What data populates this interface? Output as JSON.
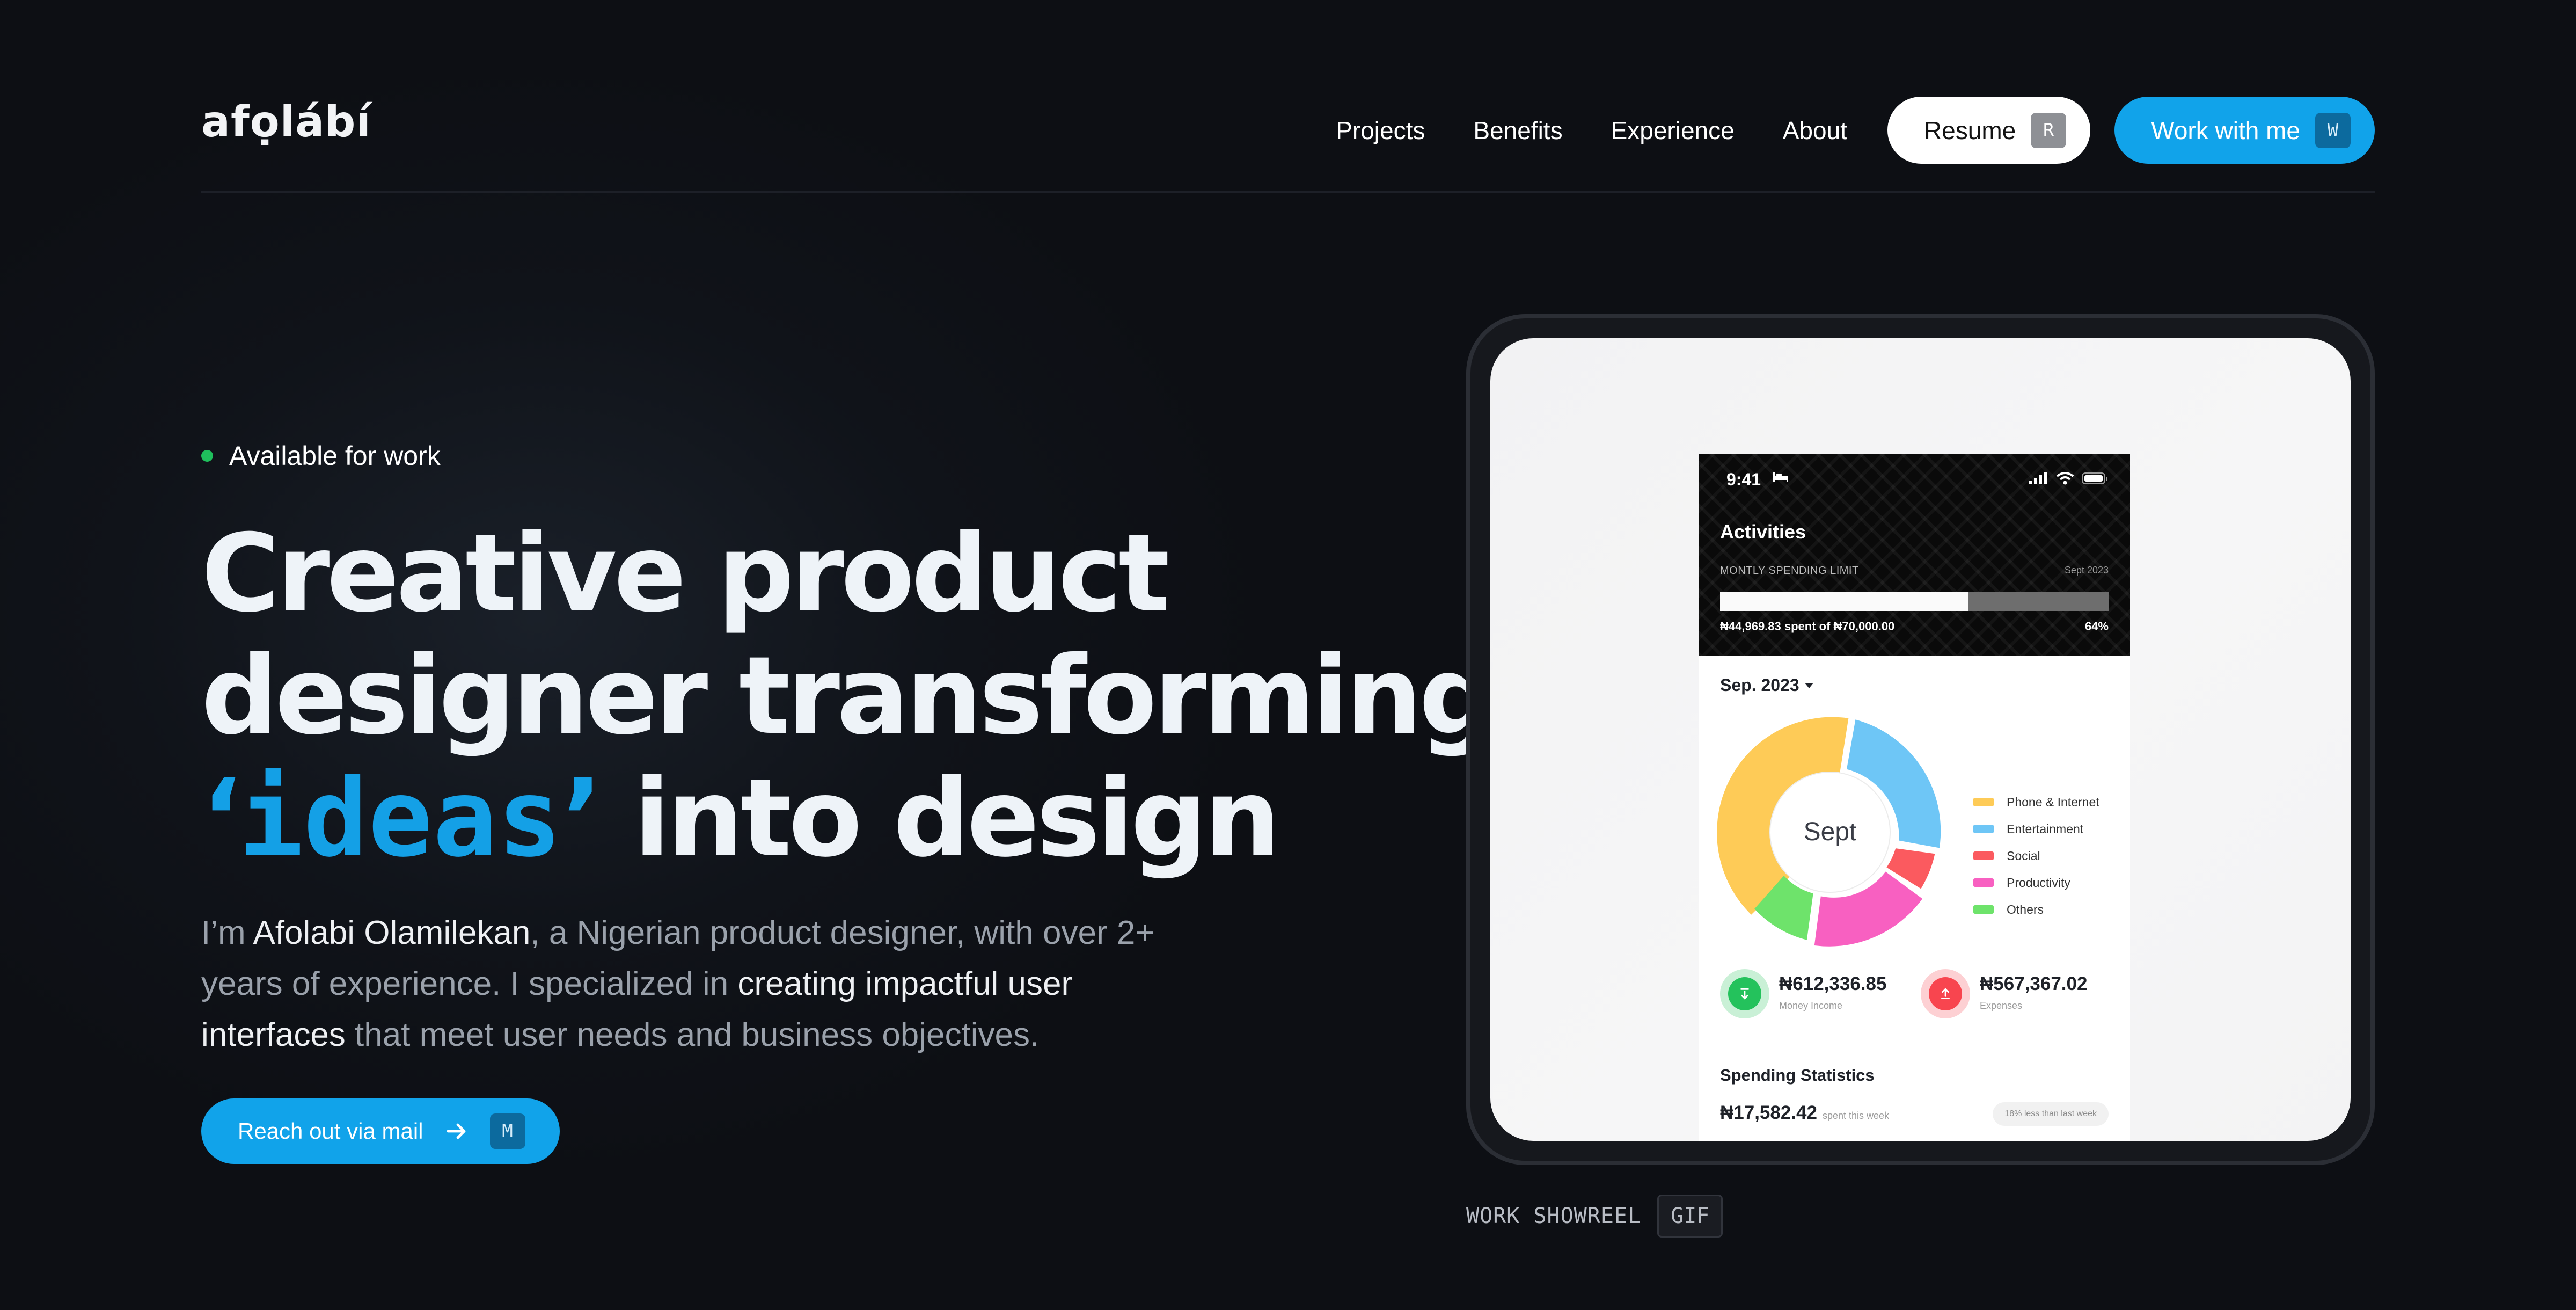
{
  "nav": {
    "logo": "afọlábí",
    "links": [
      "Projects",
      "Benefits",
      "Experience",
      "About"
    ],
    "resume_label": "Resume",
    "resume_key": "R",
    "work_label": "Work with me",
    "work_key": "W"
  },
  "hero": {
    "availability": "Available for work",
    "headline": {
      "line1": "Creative product",
      "line2": "designer transforming",
      "open_quote": "‘",
      "ideas": "ideas",
      "close_quote": "’",
      "line3_rest": "into design"
    },
    "bio": {
      "p1": "I’m ",
      "name": "Afolabi Olamilekan",
      "p2": ", a Nigerian product designer, with over 2+ years of experience. I specialized in ",
      "em2": "creating impactful user interfaces",
      "p3": " that meet user needs and business objectives."
    },
    "cta_label": "Reach out via mail",
    "cta_key": "M"
  },
  "showreel": {
    "label": "WORK SHOWREEL",
    "badge": "GIF"
  },
  "app": {
    "time": "9:41",
    "title": "Activities",
    "limit_label": "MONTLY SPENDING LIMIT",
    "limit_date": "Sept 2023",
    "progress_fraction": 0.64,
    "spent_text": "₦44,969.83 spent of ₦70,000.00",
    "percent_text": "64%",
    "month_selector": "Sep. 2023",
    "donut_center": "Sept",
    "legend": [
      "Phone & Internet",
      "Entertainment",
      "Social",
      "Productivity",
      "Others"
    ],
    "colors": {
      "phone": "#fecb57",
      "entertainment": "#6ec6f6",
      "social": "#fb5a5f",
      "productivity": "#f860c1",
      "others": "#6ee36b",
      "accent": "#11a3ea",
      "income": "#24c25c",
      "expense": "#f8454f"
    },
    "income_value": "₦612,336.85",
    "income_label": "Money Income",
    "expense_value": "₦567,367.02",
    "expense_label": "Expenses",
    "spending_title": "Spending Statistics",
    "spending_amount": "₦17,582.42",
    "spending_sub": "spent this week",
    "spending_badge": "18% less than last week"
  }
}
